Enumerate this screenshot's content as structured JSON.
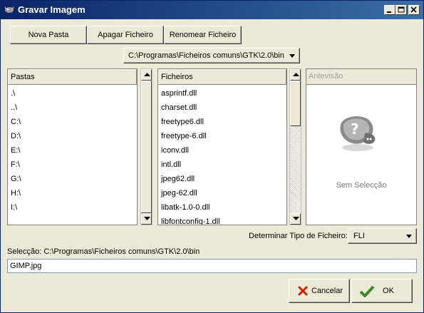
{
  "window": {
    "title": "Gravar Imagem"
  },
  "toolbar": {
    "new_folder": "Nova Pasta",
    "delete_file": "Apagar Ficheiro",
    "rename_file": "Renomear Ficheiro"
  },
  "path_combo": {
    "value": "C:\\Programas\\Ficheiros comuns\\GTK\\2.0\\bin"
  },
  "folders": {
    "header": "Pastas",
    "items": [
      ".\\",
      "..\\",
      "C:\\",
      "D:\\",
      "E:\\",
      "F:\\",
      "G:\\",
      "H:\\",
      "I:\\"
    ]
  },
  "files": {
    "header": "Ficheiros",
    "items": [
      "asprintf.dll",
      "charset.dll",
      "freetype6.dll",
      "freetype-6.dll",
      "iconv.dll",
      "intl.dll",
      "jpeg62.dll",
      "jpeg-62.dll",
      "libatk-1.0-0.dll",
      "libfontconfig-1.dll"
    ]
  },
  "preview": {
    "header": "Antevisão",
    "empty_text": "Sem Selecção"
  },
  "filetype": {
    "label": "Determinar Tipo de Ficheiro:",
    "value": "FLI"
  },
  "selection": {
    "label": "Selecção: C:\\Programas\\Ficheiros comuns\\GTK\\2.0\\bin",
    "filename": "GIMP.jpg"
  },
  "actions": {
    "cancel": "Cancelar",
    "ok": "OK"
  },
  "colors": {
    "titlebar_start": "#0a246a",
    "titlebar_end": "#3a6ea5",
    "cancel_icon": "#cc2200",
    "ok_icon": "#3a8a2a"
  }
}
